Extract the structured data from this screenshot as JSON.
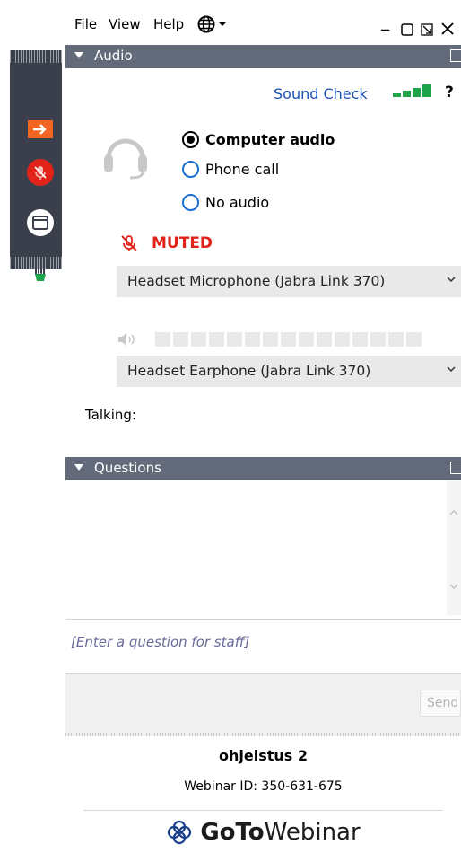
{
  "menu": {
    "file": "File",
    "view": "View",
    "help": "Help"
  },
  "window_controls": {
    "minimize": "_"
  },
  "audio": {
    "header": "Audio",
    "sound_check": "Sound Check",
    "help": "?",
    "options": [
      "Computer audio",
      "Phone call",
      "No audio"
    ],
    "selected": "Computer audio",
    "muted_label": "MUTED",
    "microphone": "Headset Microphone (Jabra Link 370)",
    "speaker": "Headset Earphone (Jabra Link 370)",
    "talking_label": "Talking:"
  },
  "questions": {
    "header": "Questions",
    "input_placeholder": "[Enter a question for staff]",
    "send_label": "Send"
  },
  "footer": {
    "webinar_name": "ohjeistus 2",
    "webinar_id": "Webinar ID: 350-631-675",
    "brand_goto": "GoTo",
    "brand_webinar": "Webinar"
  },
  "colors": {
    "accent_orange": "#f26522",
    "mute_red": "#e2231a",
    "header_gray": "#636b7a",
    "link_blue": "#1a4fb5",
    "signal_green": "#1fa34a"
  }
}
